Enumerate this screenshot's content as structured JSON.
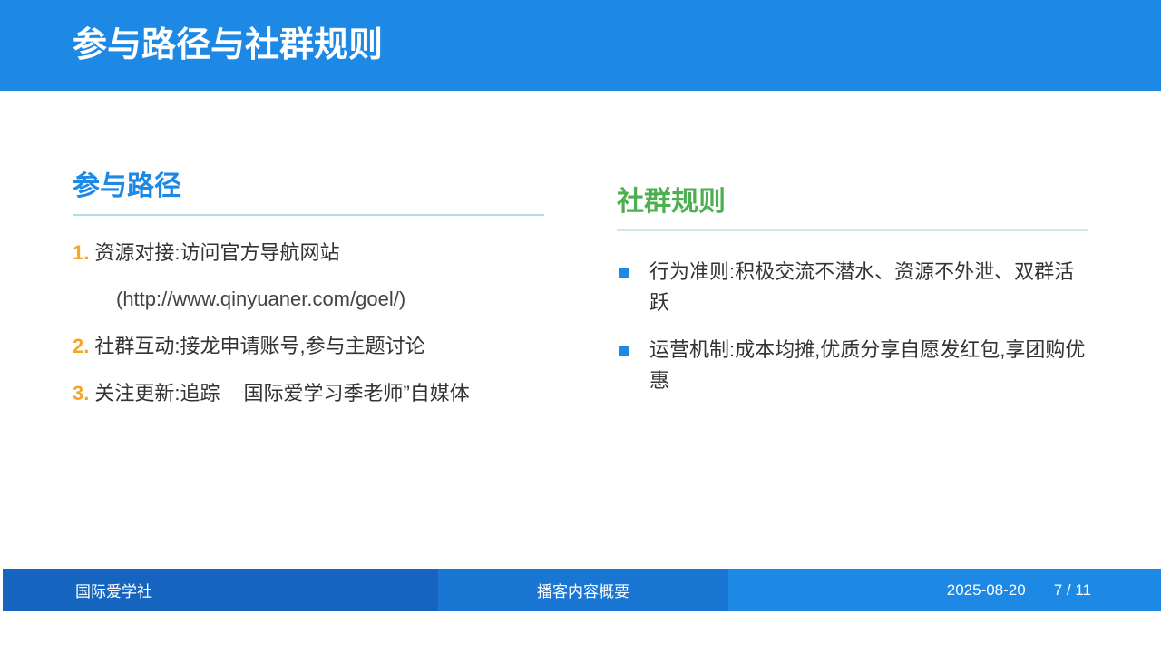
{
  "header": {
    "title": "参与路径与社群规则"
  },
  "left": {
    "title": "参与路径",
    "items": [
      {
        "num": "1.",
        "text": "资源对接:访问官方导航网站",
        "sub": "(http://www.qinyuaner.com/goel/)"
      },
      {
        "num": "2.",
        "text": "社群互动:接龙申请账号,参与主题讨论"
      },
      {
        "num": "3.",
        "text_a": "关注更新:追踪",
        "text_b": "国际爱学习季老师”自媒体"
      }
    ]
  },
  "right": {
    "title": "社群规则",
    "items": [
      {
        "text": "行为准则:积极交流不潜水、资源不外泄、双群活跃"
      },
      {
        "text": "运营机制:成本均摊,优质分享自愿发红包,享团购优惠"
      }
    ]
  },
  "footer": {
    "org": "国际爱学社",
    "section": "播客内容概要",
    "date": "2025-08-20",
    "page": "7 / 11"
  },
  "colors": {
    "primary": "#1e88e5",
    "accent_orange": "#f5a623",
    "accent_green": "#4caf50",
    "footer_dark": "#1565c0"
  }
}
